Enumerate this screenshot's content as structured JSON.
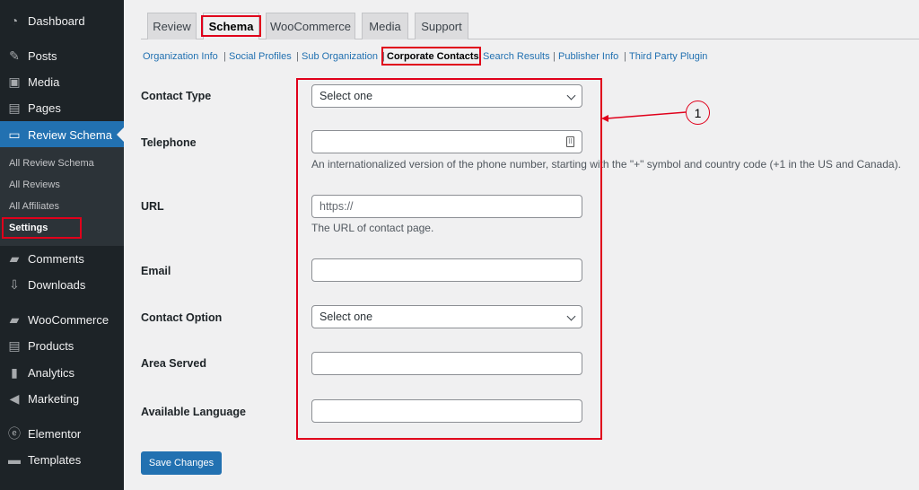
{
  "sidebar": {
    "items": [
      {
        "label": "Dashboard",
        "icon": "dashboard-icon",
        "glyph": "◔"
      },
      {
        "label": "Posts",
        "icon": "pin-icon",
        "glyph": "✎"
      },
      {
        "label": "Media",
        "icon": "media-icon",
        "glyph": "▣"
      },
      {
        "label": "Pages",
        "icon": "pages-icon",
        "glyph": "▤"
      },
      {
        "label": "Review Schema",
        "icon": "review-schema-icon",
        "glyph": "▭"
      },
      {
        "label": "Comments",
        "icon": "comments-icon",
        "glyph": "▰"
      },
      {
        "label": "Downloads",
        "icon": "downloads-icon",
        "glyph": "⇩"
      },
      {
        "label": "WooCommerce",
        "icon": "woocommerce-icon",
        "glyph": "▰"
      },
      {
        "label": "Products",
        "icon": "products-icon",
        "glyph": "▤"
      },
      {
        "label": "Analytics",
        "icon": "analytics-icon",
        "glyph": "▮"
      },
      {
        "label": "Marketing",
        "icon": "marketing-icon",
        "glyph": "◀"
      },
      {
        "label": "Elementor",
        "icon": "elementor-icon",
        "glyph": "ⓔ"
      },
      {
        "label": "Templates",
        "icon": "templates-icon",
        "glyph": "▬"
      }
    ],
    "submenu": [
      "All Review Schema",
      "All Reviews",
      "All Affiliates",
      "Settings"
    ]
  },
  "tabs": [
    "Review",
    "Schema",
    "WooCommerce",
    "Media",
    "Support"
  ],
  "subnav": [
    "Organization Info",
    "Social Profiles",
    "Sub Organization",
    "Corporate Contacts",
    "Search Results",
    "Publisher Info",
    "Third Party Plugin"
  ],
  "form": {
    "contact_type": {
      "label": "Contact Type",
      "value": "Select one"
    },
    "telephone": {
      "label": "Telephone",
      "value": "",
      "help": "An internationalized version of the phone number, starting with the \"+\" symbol and country code (+1 in the US and Canada)."
    },
    "url": {
      "label": "URL",
      "placeholder": "https://",
      "help": "The URL of contact page."
    },
    "email": {
      "label": "Email",
      "value": ""
    },
    "contact_option": {
      "label": "Contact Option",
      "value": "Select one"
    },
    "area_served": {
      "label": "Area Served",
      "value": ""
    },
    "available_language": {
      "label": "Available Language",
      "value": ""
    }
  },
  "save_label": "Save Changes",
  "callout_number": "1",
  "colors": {
    "accent": "#2271b1",
    "highlight": "#e0001b",
    "sidebar": "#1d2327"
  }
}
